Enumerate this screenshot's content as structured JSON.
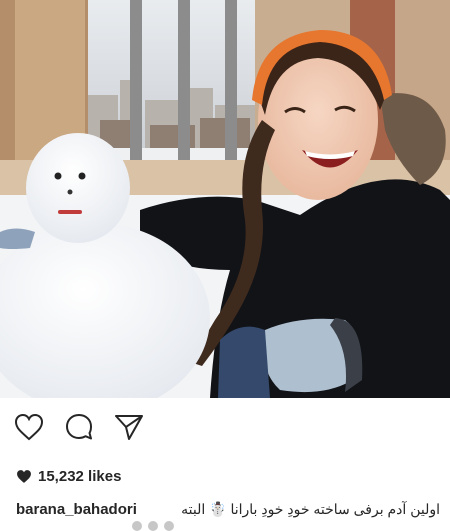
{
  "post": {
    "photo_alt": "",
    "likes_text": "15,232 likes",
    "username": "barana_bahadori",
    "caption": "اولین آدم برفی ساخته خودِ خودِ بارانا ☃️ البته"
  },
  "actions": {
    "like_icon": "heart-outline-icon",
    "comment_icon": "comment-bubble-icon",
    "share_icon": "paper-plane-icon"
  },
  "colors": {
    "text": "#262626",
    "icon": "#262626"
  }
}
